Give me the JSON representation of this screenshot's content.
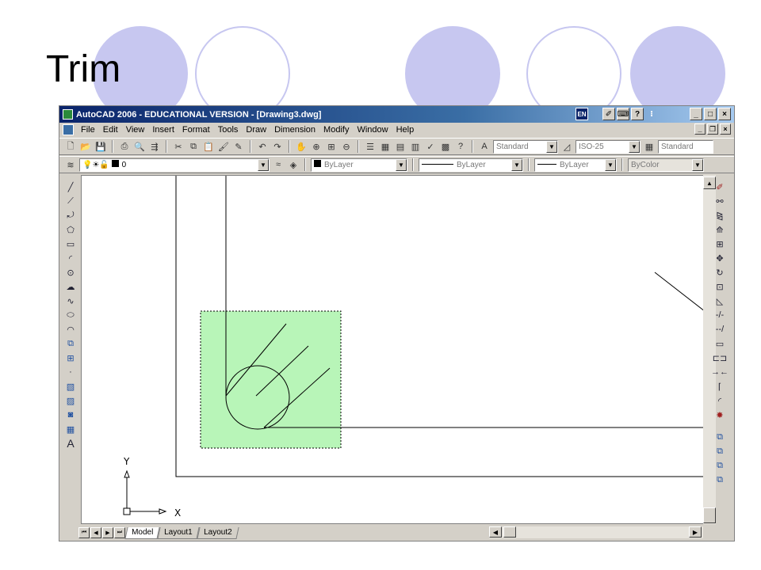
{
  "slide": {
    "title": "Trim",
    "accent_color": "#c7c7f0"
  },
  "window": {
    "title": "AutoCAD 2006 - EDUCATIONAL VERSION - [Drawing3.dwg]",
    "lang_badge": "EN",
    "help_icon": "?",
    "min_label": "_",
    "max_label": "□",
    "close_label": "×"
  },
  "menu": {
    "items": [
      {
        "label": "File"
      },
      {
        "label": "Edit"
      },
      {
        "label": "View"
      },
      {
        "label": "Insert"
      },
      {
        "label": "Format"
      },
      {
        "label": "Tools"
      },
      {
        "label": "Draw"
      },
      {
        "label": "Dimension"
      },
      {
        "label": "Modify"
      },
      {
        "label": "Window"
      },
      {
        "label": "Help"
      }
    ]
  },
  "toolbar1": {
    "text_style": "Standard",
    "dim_style": "ISO-25",
    "table_style": "Standard"
  },
  "toolbar2": {
    "layer": "0",
    "color": "ByLayer",
    "linetype": "ByLayer",
    "lineweight": "ByLayer",
    "plotstyle": "ByColor"
  },
  "drawing": {
    "ucs_y_label": "Y",
    "ucs_x_label": "X",
    "selection_color": "#b8f5b8"
  },
  "layout_tabs": [
    {
      "label": "Model",
      "active": true
    },
    {
      "label": "Layout1",
      "active": false
    },
    {
      "label": "Layout2",
      "active": false
    }
  ],
  "icons": {
    "left_draw": [
      "line-icon",
      "construction-line-icon",
      "polyline-icon",
      "polygon-icon",
      "rectangle-icon",
      "arc-icon",
      "circle-icon",
      "revision-cloud-icon",
      "spline-icon",
      "ellipse-icon",
      "ellipse-arc-icon",
      "insert-block-icon",
      "make-block-icon",
      "point-icon",
      "hatch-icon",
      "gradient-icon",
      "region-icon",
      "table-icon",
      "multiline-text-icon"
    ],
    "right_modify": [
      "erase-icon",
      "copy-icon",
      "mirror-icon",
      "offset-icon",
      "array-icon",
      "move-icon",
      "rotate-icon",
      "scale-icon",
      "stretch-icon",
      "trim-icon",
      "extend-icon",
      "break-at-point-icon",
      "break-icon",
      "join-icon",
      "chamfer-icon",
      "fillet-icon",
      "explode-icon",
      "draworder-front-icon",
      "draworder-back-icon",
      "draworder-above-icon",
      "draworder-under-icon"
    ]
  }
}
